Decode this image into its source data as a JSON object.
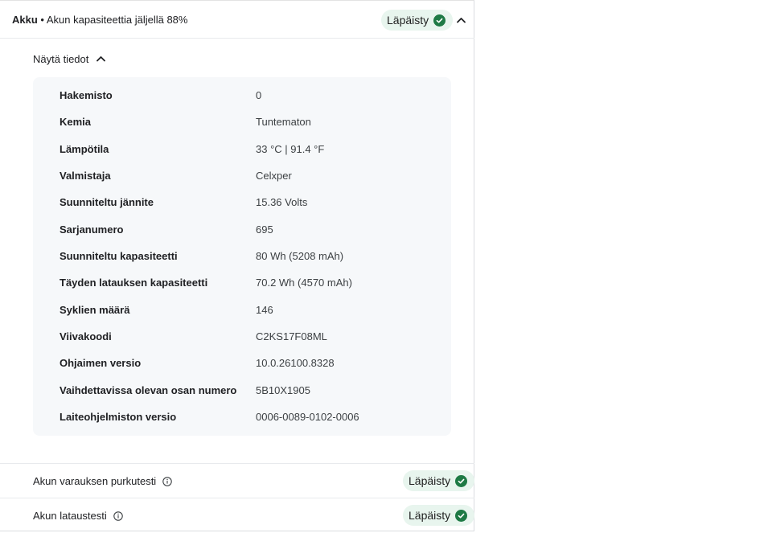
{
  "battery": {
    "title_bold": "Akku",
    "separator": " • ",
    "subtitle": "Akun kapasiteettia jäljellä 88%",
    "status": "Läpäisty"
  },
  "details": {
    "toggle_label": "Näytä tiedot",
    "rows": [
      {
        "key": "Hakemisto",
        "value": "0"
      },
      {
        "key": "Kemia",
        "value": "Tuntematon"
      },
      {
        "key": "Lämpötila",
        "value": "33 °C | 91.4 °F"
      },
      {
        "key": "Valmistaja",
        "value": "Celxper"
      },
      {
        "key": "Suunniteltu jännite",
        "value": "15.36 Volts"
      },
      {
        "key": "Sarjanumero",
        "value": "695"
      },
      {
        "key": "Suunniteltu kapasiteetti",
        "value": "80 Wh (5208 mAh)"
      },
      {
        "key": "Täyden latauksen kapasiteetti",
        "value": "70.2 Wh (4570 mAh)"
      },
      {
        "key": "Syklien määrä",
        "value": "146"
      },
      {
        "key": "Viivakoodi",
        "value": "C2KS17F08ML"
      },
      {
        "key": "Ohjaimen versio",
        "value": "10.0.26100.8328"
      },
      {
        "key": "Vaihdettavissa olevan osan numero",
        "value": "5B10X1905"
      },
      {
        "key": "Laiteohjelmiston versio",
        "value": "0006-0089-0102-0006"
      }
    ]
  },
  "tests": [
    {
      "name": "Akun varauksen purkutesti",
      "status": "Läpäisty"
    },
    {
      "name": "Akun lataustesti",
      "status": "Läpäisty"
    }
  ],
  "colors": {
    "pass_green": "#1e7a45",
    "badge_bg": "#e8f5ee",
    "details_bg": "#f6f8fa"
  },
  "icons": {
    "status": "check-circle-icon",
    "collapse": "chevron-up-icon",
    "info": "info-icon"
  }
}
